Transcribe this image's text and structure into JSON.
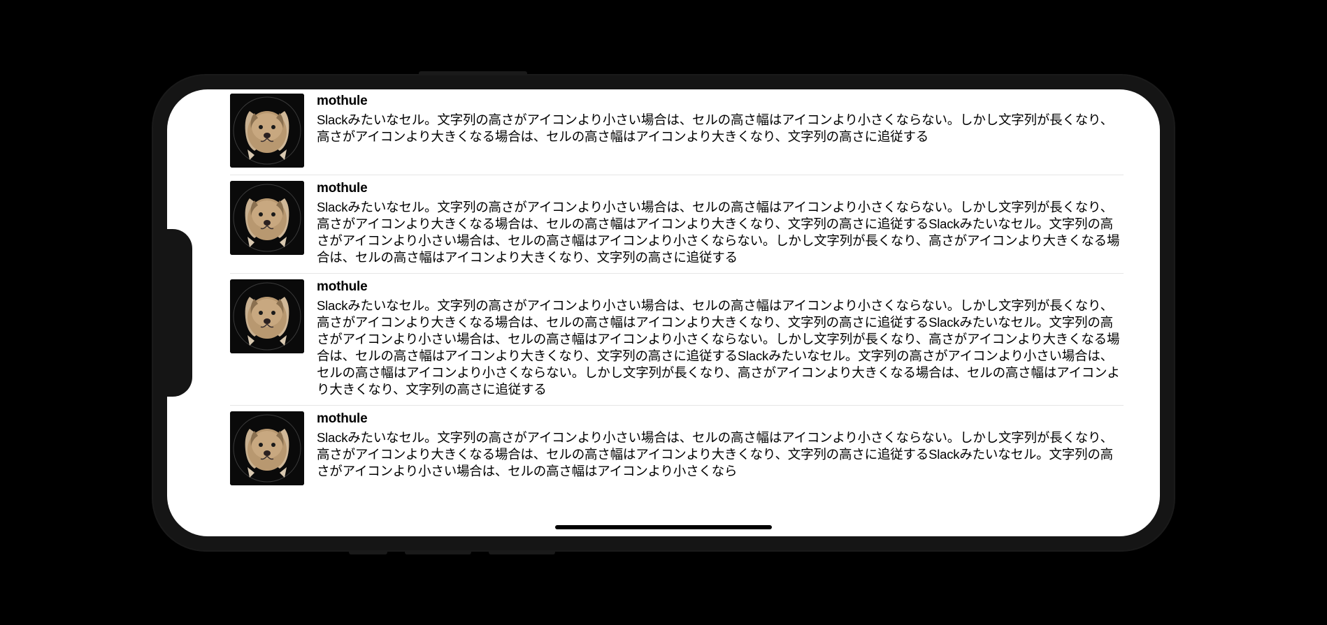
{
  "cells": [
    {
      "username": "mothule",
      "message": "Slackみたいなセル。文字列の高さがアイコンより小さい場合は、セルの高さ幅はアイコンより小さくならない。しかし文字列が長くなり、高さがアイコンより大きくなる場合は、セルの高さ幅はアイコンより大きくなり、文字列の高さに追従する"
    },
    {
      "username": "mothule",
      "message": "Slackみたいなセル。文字列の高さがアイコンより小さい場合は、セルの高さ幅はアイコンより小さくならない。しかし文字列が長くなり、高さがアイコンより大きくなる場合は、セルの高さ幅はアイコンより大きくなり、文字列の高さに追従するSlackみたいなセル。文字列の高さがアイコンより小さい場合は、セルの高さ幅はアイコンより小さくならない。しかし文字列が長くなり、高さがアイコンより大きくなる場合は、セルの高さ幅はアイコンより大きくなり、文字列の高さに追従する"
    },
    {
      "username": "mothule",
      "message": "Slackみたいなセル。文字列の高さがアイコンより小さい場合は、セルの高さ幅はアイコンより小さくならない。しかし文字列が長くなり、高さがアイコンより大きくなる場合は、セルの高さ幅はアイコンより大きくなり、文字列の高さに追従するSlackみたいなセル。文字列の高さがアイコンより小さい場合は、セルの高さ幅はアイコンより小さくならない。しかし文字列が長くなり、高さがアイコンより大きくなる場合は、セルの高さ幅はアイコンより大きくなり、文字列の高さに追従するSlackみたいなセル。文字列の高さがアイコンより小さい場合は、セルの高さ幅はアイコンより小さくならない。しかし文字列が長くなり、高さがアイコンより大きくなる場合は、セルの高さ幅はアイコンより大きくなり、文字列の高さに追従する"
    },
    {
      "username": "mothule",
      "message": "Slackみたいなセル。文字列の高さがアイコンより小さい場合は、セルの高さ幅はアイコンより小さくならない。しかし文字列が長くなり、高さがアイコンより大きくなる場合は、セルの高さ幅はアイコンより大きくなり、文字列の高さに追従するSlackみたいなセル。文字列の高さがアイコンより小さい場合は、セルの高さ幅はアイコンより小さくなら"
    }
  ]
}
